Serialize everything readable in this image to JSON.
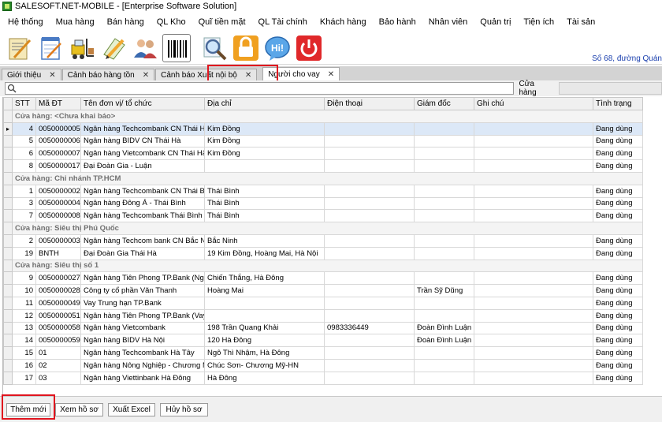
{
  "window": {
    "title": "SALESOFT.NET-MOBILE - [Enterprise Software Solution]"
  },
  "menu": [
    "Hệ thống",
    "Mua hàng",
    "Bán hàng",
    "QL Kho",
    "Quĩ tiền mặt",
    "QL Tài chính",
    "Khách hàng",
    "Bảo hành",
    "Nhân viên",
    "Quản trị",
    "Tiện ích",
    "Tài sản"
  ],
  "toolbar_icons": [
    "document-edit-icon",
    "notepad-icon",
    "forklift-icon",
    "pencil-sheet-icon",
    "users-icon",
    "barcode-icon",
    "magnifier-icon",
    "lock-icon",
    "chat-bubble-icon",
    "power-icon"
  ],
  "store_info": "Số 68, đường Quán",
  "tabs": [
    {
      "label": "Giới thiệu"
    },
    {
      "label": "Cảnh báo hàng tồn"
    },
    {
      "label": "Cảnh báo Xuất nội bộ"
    },
    {
      "label": "Người cho vay"
    }
  ],
  "filter": {
    "search_value": "",
    "store_label": "Cửa hàng",
    "store_value": ""
  },
  "columns": [
    "STT",
    "Mã ĐT",
    "Tên đơn vị/ tổ chức",
    "Địa chỉ",
    "Điện thoại",
    "Giám đốc",
    "Ghi chú",
    "Tình trạng"
  ],
  "groups": [
    {
      "title": "Cửa hàng: <Chưa khai báo>",
      "rows": [
        {
          "stt": "4",
          "code": "0050000005",
          "name": "Ngân hàng Techcombank CN Thái Hà",
          "address": "Kim Đồng",
          "phone": "",
          "director": "",
          "note": "",
          "status": "Đang dùng"
        },
        {
          "stt": "5",
          "code": "0050000006",
          "name": "Ngân hàng BIDV CN Thái Hà",
          "address": "Kim Đồng",
          "phone": "",
          "director": "",
          "note": "",
          "status": "Đang dùng"
        },
        {
          "stt": "6",
          "code": "0050000007",
          "name": "Ngân hàng Vietcombank CN Thái Hà",
          "address": "Kim Đồng",
          "phone": "",
          "director": "",
          "note": "",
          "status": "Đang dùng"
        },
        {
          "stt": "8",
          "code": "0050000017",
          "name": "Đại Đoàn Gia - Luận",
          "address": "",
          "phone": "",
          "director": "",
          "note": "",
          "status": "Đang dùng"
        }
      ]
    },
    {
      "title": "Cửa hàng: Chi nhánh TP.HCM",
      "rows": [
        {
          "stt": "1",
          "code": "0050000002",
          "name": "Ngân hàng Techcombank CN Thái Bình",
          "address": "Thái Bình",
          "phone": "",
          "director": "",
          "note": "",
          "status": "Đang dùng"
        },
        {
          "stt": "3",
          "code": "0050000004",
          "name": "Ngân hàng Đông Á - Thái Bình",
          "address": "Thái Bình",
          "phone": "",
          "director": "",
          "note": "",
          "status": "Đang dùng"
        },
        {
          "stt": "7",
          "code": "0050000008",
          "name": "Ngân hàng Techcombank Thái Bình",
          "address": "Thái Bình",
          "phone": "",
          "director": "",
          "note": "",
          "status": "Đang dùng"
        }
      ]
    },
    {
      "title": "Cửa hàng: Siêu thị Phú Quốc",
      "rows": [
        {
          "stt": "2",
          "code": "0050000003",
          "name": "Ngân hàng Techcom bank CN  Bắc Ninh",
          "address": "Bắc Ninh",
          "phone": "",
          "director": "",
          "note": "",
          "status": "Đang dùng"
        },
        {
          "stt": "19",
          "code": "BNTH",
          "name": "Đại Đoàn Gia Thái Hà",
          "address": "19 Kim Đồng, Hoàng Mai, Hà Nội",
          "phone": "",
          "director": "",
          "note": "",
          "status": "Đang dùng"
        }
      ]
    },
    {
      "title": "Cửa hàng: Siêu thị số 1",
      "rows": [
        {
          "stt": "9",
          "code": "0050000027",
          "name": "Ngân hàng Tiên Phong TP.Bank  (Ngân ...",
          "address": "Chiến Thắng, Hà Đông",
          "phone": "",
          "director": "",
          "note": "",
          "status": "Đang dùng"
        },
        {
          "stt": "10",
          "code": "0050000028",
          "name": "Công ty cổ phần Văn Thanh",
          "address": "Hoàng Mai",
          "phone": "",
          "director": "Trần Sỹ Dũng",
          "note": "",
          "status": "Đang dùng"
        },
        {
          "stt": "11",
          "code": "0050000049",
          "name": "Vay Trung hạn TP.Bank",
          "address": "",
          "phone": "",
          "director": "",
          "note": "",
          "status": "Đang dùng"
        },
        {
          "stt": "12",
          "code": "0050000051",
          "name": "Ngân hàng Tiên Phong TP.Bank (Vay Tí...",
          "address": "",
          "phone": "",
          "director": "",
          "note": "",
          "status": "Đang dùng"
        },
        {
          "stt": "13",
          "code": "0050000058",
          "name": "Ngân hàng Vietcombank",
          "address": "198 Trần Quang Khải",
          "phone": "0983336449",
          "director": "Đoàn Đình Luận",
          "note": "",
          "status": "Đang dùng"
        },
        {
          "stt": "14",
          "code": "0050000059",
          "name": "Ngân hàng BIDV Hà Nội",
          "address": "120 Hà Đông",
          "phone": "",
          "director": "Đoàn Đình Luận",
          "note": "",
          "status": "Đang dùng"
        },
        {
          "stt": "15",
          "code": "01",
          "name": "Ngân hàng Techcombank Hà Tây",
          "address": "Ngô Thì Nhậm, Hà Đông",
          "phone": "",
          "director": "",
          "note": "",
          "status": "Đang dùng"
        },
        {
          "stt": "16",
          "code": "02",
          "name": "Ngân hàng Nông  Nghiệp - Chương Mỹ",
          "address": "Chúc Sơn- Chương Mỹ-HN",
          "phone": "",
          "director": "",
          "note": "",
          "status": "Đang dùng"
        },
        {
          "stt": "17",
          "code": "03",
          "name": "Ngân hàng Viettinbank Hà Đông",
          "address": "Hà Đông",
          "phone": "",
          "director": "",
          "note": "",
          "status": "Đang dùng"
        }
      ]
    }
  ],
  "buttons": {
    "add": "Thêm mới",
    "view": "Xem hồ sơ",
    "export": "Xuất Excel",
    "cancel": "Hủy hồ sơ"
  },
  "colors": {
    "highlight_red": "#e0141e",
    "selected_row": "#dce8f7",
    "info_blue": "#1a3fae"
  }
}
